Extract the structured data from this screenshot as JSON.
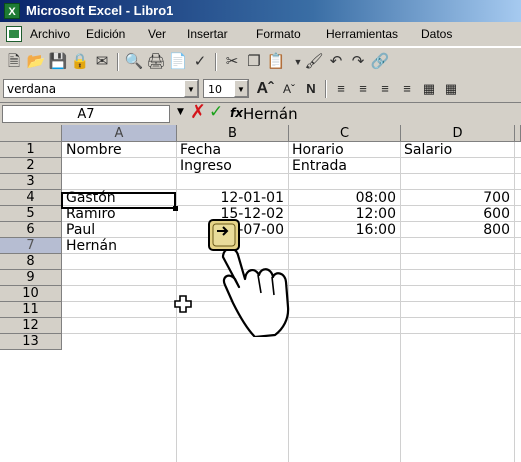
{
  "window": {
    "app_icon": "excel-icon",
    "title": "Microsoft Excel - Libro1"
  },
  "menu": {
    "items": [
      "Archivo",
      "Edición",
      "Ver",
      "Insertar",
      "Formato",
      "Herramientas",
      "Datos"
    ]
  },
  "toolbar_standard": {
    "icons": [
      "new-icon",
      "open-icon",
      "save-icon",
      "permission-icon",
      "email-icon",
      "search-icon",
      "print-icon",
      "print-preview-icon",
      "spelling-icon",
      "cut-icon",
      "copy-icon",
      "paste-icon",
      "format-painter-icon",
      "undo-icon",
      "redo-icon",
      "link-icon"
    ]
  },
  "toolbar_formatting": {
    "font": "verdana",
    "size": "10",
    "icons": [
      "grow-font-icon",
      "shrink-font-icon",
      "bold-icon",
      "align-left-icon",
      "align-center-icon",
      "align-right-icon",
      "justify-icon",
      "merge-center-icon",
      "borders-icon"
    ]
  },
  "formula_bar": {
    "name_box": "A7",
    "fx": "fx",
    "value": "Hernán"
  },
  "sheet": {
    "columns": [
      "A",
      "B",
      "C",
      "D"
    ],
    "active_column": "A",
    "rows": [
      "1",
      "2",
      "3",
      "4",
      "5",
      "6",
      "7",
      "8",
      "9",
      "10",
      "11",
      "12",
      "13"
    ],
    "active_row": "7",
    "cells": {
      "A1": "Nombre",
      "B1": "Fecha",
      "C1": "Horario",
      "D1": "Salario",
      "B2": "Ingreso",
      "C2": "Entrada",
      "A4": "Gastón",
      "B4": "12-01-01",
      "C4": "08:00",
      "D4": "700",
      "A5": "Ramiro",
      "B5": "15-12-02",
      "C5": "12:00",
      "D5": "600",
      "A6": "Paul",
      "B6": "16-07-00",
      "C6": "16:00",
      "D6": "800",
      "A7": "Hernán"
    },
    "selected_cell": "A7"
  },
  "overlay": {
    "hand_icon": "pointing-hand-icon",
    "cursor_icon": "cell-cursor-icon"
  },
  "colors": {
    "title_start": "#0a246a",
    "title_end": "#a6caf0",
    "header_bg": "#d4d0c8",
    "active_header_bg": "#b6bdd2",
    "cancel_x": "#d4141a",
    "ok_check": "#1aa11a"
  }
}
